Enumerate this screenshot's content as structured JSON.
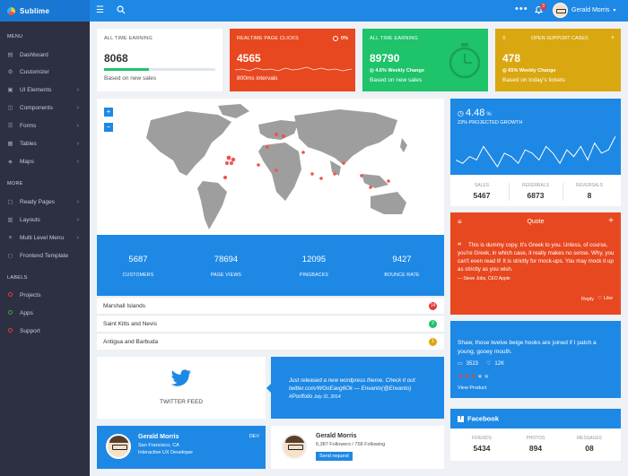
{
  "brand": {
    "name": "Sublime"
  },
  "topbar": {
    "user_name": "Gerald Morris",
    "notification_count": "3"
  },
  "sidebar": {
    "sections": [
      "MENU",
      "MORE",
      "LABELS"
    ],
    "menu": [
      {
        "label": "Dashboard",
        "icon": "dashboard-icon"
      },
      {
        "label": "Customizer",
        "icon": "gear-icon"
      },
      {
        "label": "UI Elements",
        "icon": "box-icon"
      },
      {
        "label": "Components",
        "icon": "layers-icon"
      },
      {
        "label": "Forms",
        "icon": "form-icon"
      },
      {
        "label": "Tables",
        "icon": "table-icon"
      },
      {
        "label": "Maps",
        "icon": "map-icon"
      }
    ],
    "more": [
      {
        "label": "Ready Pages",
        "icon": "page-icon"
      },
      {
        "label": "Layouts",
        "icon": "layout-icon"
      },
      {
        "label": "Multi Level Menu",
        "icon": "menu-icon"
      },
      {
        "label": "Frontend Template",
        "icon": "template-icon"
      }
    ],
    "labels": [
      {
        "label": "Projects",
        "color": "#e53935"
      },
      {
        "label": "Apps",
        "color": "#43a047"
      },
      {
        "label": "Support",
        "color": "#e53935"
      }
    ]
  },
  "stats": [
    {
      "title": "ALL TIME EARNING",
      "value": "8068",
      "sub": "Based on new sales",
      "progress": 0.4,
      "bg": "#ffffff",
      "accent": "#1ec36a"
    },
    {
      "title": "REALTIME PAGE CLICKS",
      "badge": "0%",
      "value": "4565",
      "sub": "800ms intervals",
      "bg": "#e8481f"
    },
    {
      "title": "ALL TIME EARNING",
      "value": "89790",
      "change": "4.6% Weekly Change",
      "sub": "Based on new sales",
      "bg": "#1ec36a"
    },
    {
      "title": "OPEN SUPPORT CASES",
      "value": "478",
      "change": "65% Weekly Change",
      "sub": "Based on today's tickets",
      "bg": "#d9a710"
    }
  ],
  "map": {
    "zoom_in": "+",
    "zoom_out": "−"
  },
  "band": [
    {
      "value": "5687",
      "label": "CUSTOMERS"
    },
    {
      "value": "78694",
      "label": "PAGE VIEWS"
    },
    {
      "value": "12095",
      "label": "PINGBACKS"
    },
    {
      "value": "9427",
      "label": "BOUNCE RATE"
    }
  ],
  "list": [
    {
      "label": "Marshall Islands",
      "count": "14",
      "color": "#e53935"
    },
    {
      "label": "Saint Kitts and Nevis",
      "count": "2",
      "color": "#1ec36a"
    },
    {
      "label": "Antigua and Barbuda",
      "count": "1",
      "color": "#d9a710"
    }
  ],
  "growth": {
    "value": "4.48",
    "unit": "%",
    "label": "23% PROJECTED GROWTH",
    "stats": [
      {
        "label": "SALES",
        "value": "5467"
      },
      {
        "label": "REFERRALS",
        "value": "6873"
      },
      {
        "label": "REVERSALS",
        "value": "8"
      }
    ],
    "chart_data": {
      "type": "line",
      "values": [
        5,
        4,
        6,
        5,
        9,
        6,
        3,
        7,
        6,
        4,
        8,
        7,
        5,
        9,
        7,
        4,
        8,
        6,
        9,
        5,
        10,
        7,
        8,
        12
      ]
    }
  },
  "quote": {
    "title": "Quote",
    "text": "This is dummy copy. It's Greek to you. Unless, of course, you're Greek, in which case, it really makes no sense. Why, you can't even read it! It is strictly for mock-ups. You may mock it up as strictly as you wish.",
    "author": "— Steve Jobs, CEO Apple",
    "reply": "Reply",
    "like": "Like"
  },
  "product": {
    "text": "Shaw, those twelve beige hooks are joined if I patch a young, gooey mouth.",
    "comments": "3523",
    "likes": "12K",
    "rating": 3,
    "link": "View Product"
  },
  "facebook": {
    "title": "Facebook",
    "stats": [
      {
        "label": "FRIENDS",
        "value": "5434"
      },
      {
        "label": "PHOTOS",
        "value": "894"
      },
      {
        "label": "MESSAGES",
        "value": "08"
      }
    ]
  },
  "twitter_feed": {
    "label": "TWITTER FEED"
  },
  "tweet": {
    "text": "Just released a new wordpress theme. Check it out: twitter.com/WGnEavg6Ok — Envanto(@Envanto) #Portfolio",
    "date": "July 31, 2014"
  },
  "profile1": {
    "name": "Gerald Morris",
    "location": "San Francisco, CA",
    "role": "Interactive UX Developer",
    "tag": "DEV"
  },
  "profile2": {
    "name": "Gerald Morris",
    "followers": "6,387 Followers / 758 Following",
    "button": "Send request"
  }
}
